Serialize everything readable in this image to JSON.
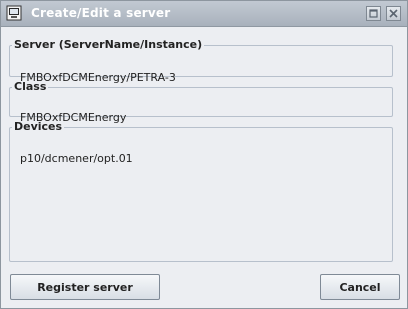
{
  "window": {
    "title": "Create/Edit a server",
    "controls": {
      "maximize_icon": "maximize-icon",
      "close_icon": "close-icon"
    }
  },
  "groups": {
    "server": {
      "label": "Server  (ServerName/Instance)",
      "value": "FMBOxfDCMEnergy/PETRA-3"
    },
    "class": {
      "label": "Class",
      "value": "FMBOxfDCMEnergy"
    },
    "devices": {
      "label": "Devices",
      "value": "p10/dcmener/opt.01"
    }
  },
  "buttons": {
    "register": "Register server",
    "cancel": "Cancel"
  }
}
